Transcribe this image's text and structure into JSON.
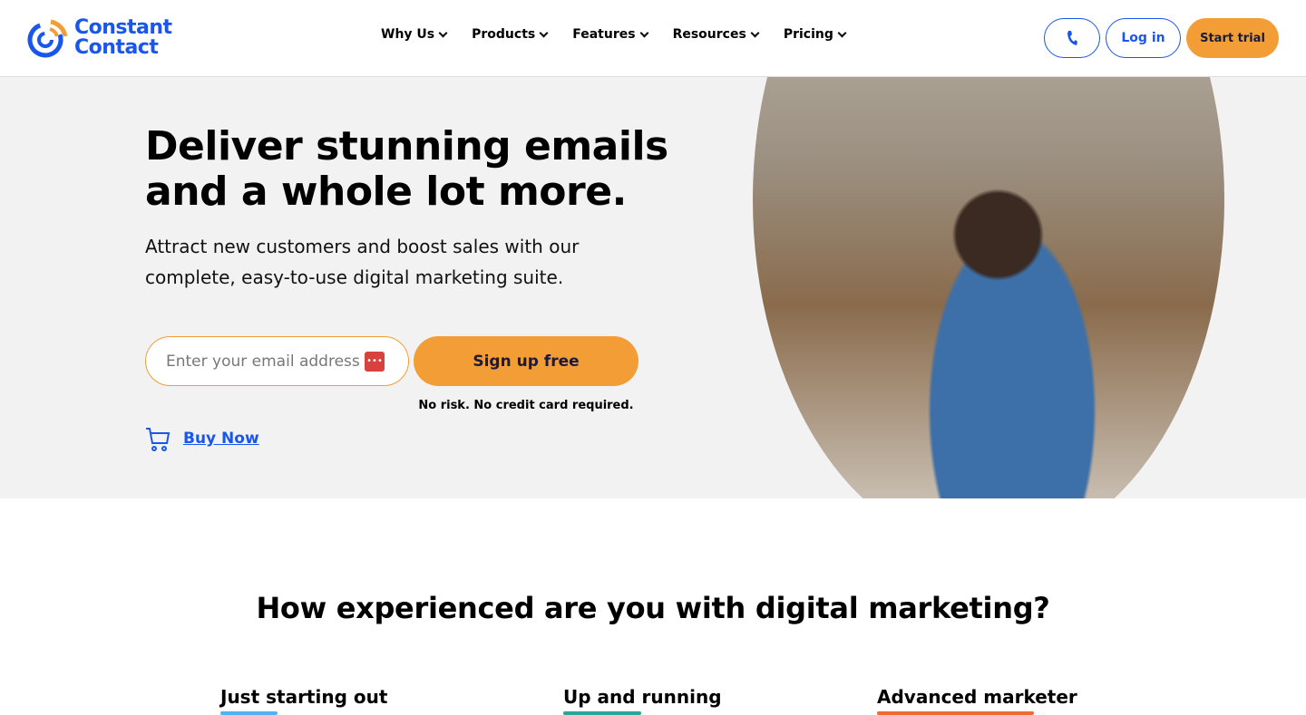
{
  "header": {
    "logo": "Constant Contact",
    "logo_line1": "Constant",
    "logo_line2": "Contact",
    "nav": [
      {
        "label": "Why Us"
      },
      {
        "label": "Products"
      },
      {
        "label": "Features"
      },
      {
        "label": "Resources"
      },
      {
        "label": "Pricing"
      }
    ],
    "login": "Log in",
    "start_trial": "Start trial",
    "phone_icon": "phone-icon"
  },
  "hero": {
    "title_line1": "Deliver stunning emails",
    "title_line2": "and a whole lot more.",
    "subtitle_line1": "Attract new customers and boost sales with our",
    "subtitle_line2": "complete, easy-to-use digital marketing suite.",
    "email_placeholder": "Enter your email address",
    "signup": "Sign up free",
    "no_risk": "No risk. No credit card required.",
    "buy_now": "Buy Now"
  },
  "experience": {
    "title": "How experienced are you with digital marketing?",
    "levels": [
      {
        "label": "Just starting out",
        "color": "#4fb3f0"
      },
      {
        "label": "Up and running",
        "color": "#2aa59a"
      },
      {
        "label": "Advanced marketer",
        "color": "#f06a35"
      }
    ]
  },
  "colors": {
    "brand": "#1856ed",
    "accent": "#f29d35"
  }
}
